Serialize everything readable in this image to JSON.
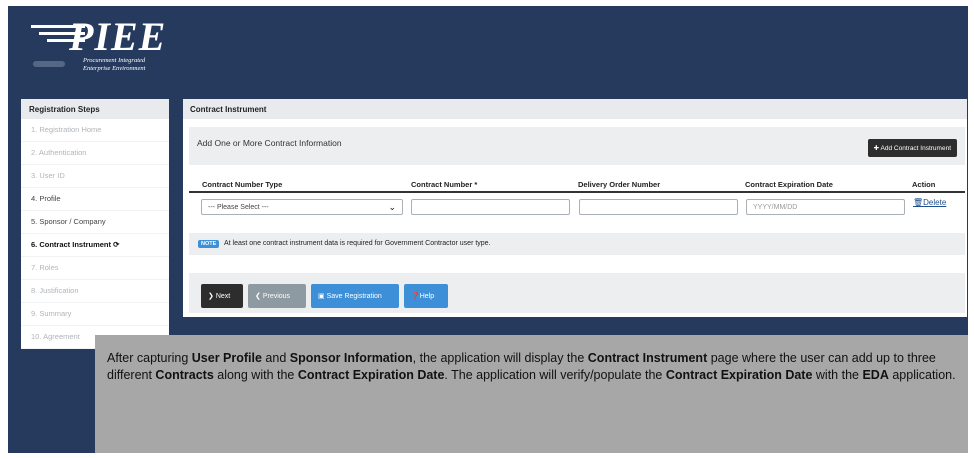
{
  "logo": {
    "wordmark": "PIEE",
    "subtitle_line1": "Procurement Integrated",
    "subtitle_line2": "Enterprise Environment"
  },
  "sidebar": {
    "title": "Registration Steps",
    "steps": [
      {
        "label": "1. Registration Home",
        "state": "disabled"
      },
      {
        "label": "2. Authentication",
        "state": "disabled"
      },
      {
        "label": "3. User ID",
        "state": "disabled"
      },
      {
        "label": "4. Profile",
        "state": "done"
      },
      {
        "label": "5. Sponsor / Company",
        "state": "done"
      },
      {
        "label": "6. Contract Instrument",
        "state": "current"
      },
      {
        "label": "7. Roles",
        "state": "disabled"
      },
      {
        "label": "8. Justification",
        "state": "disabled"
      },
      {
        "label": "9. Summary",
        "state": "disabled"
      },
      {
        "label": "10. Agreement",
        "state": "disabled"
      }
    ]
  },
  "main": {
    "title": "Contract Instrument",
    "info": "Add One or More Contract Information",
    "add_button": "Add Contract Instrument",
    "columns": [
      "Contract Number Type",
      "Contract Number *",
      "Delivery Order Number",
      "Contract Expiration Date",
      "Action"
    ],
    "row": {
      "type_select": "--- Please Select ---",
      "contract_number": "",
      "delivery_order_number": "",
      "expiration_placeholder": "YYYY/MM/DD",
      "delete_label": "Delete"
    },
    "note_badge": "NOTE",
    "note_text": "At least one contract instrument data is required for Government Contractor user type.",
    "buttons": {
      "next": "Next",
      "previous": "Previous",
      "save": "Save Registration",
      "help": "Help"
    }
  },
  "caption": {
    "parts": [
      {
        "t": "After capturing ",
        "b": false
      },
      {
        "t": "User Profile",
        "b": true
      },
      {
        "t": " and ",
        "b": false
      },
      {
        "t": "Sponsor Information",
        "b": true
      },
      {
        "t": ", the application will display the ",
        "b": false
      },
      {
        "t": "Contract Instrument",
        "b": true
      },
      {
        "t": " page where the user can add up to three different ",
        "b": false
      },
      {
        "t": "Contracts",
        "b": true
      },
      {
        "t": " along with the ",
        "b": false
      },
      {
        "t": "Contract Expiration Date",
        "b": true
      },
      {
        "t": ". The application will verify/populate the ",
        "b": false
      },
      {
        "t": "Contract Expiration Date",
        "b": true
      },
      {
        "t": " with the ",
        "b": false
      },
      {
        "t": "EDA",
        "b": true
      },
      {
        "t": " application.",
        "b": false
      }
    ]
  },
  "colors": {
    "background": "#263a5e",
    "primary_button": "#3d8fd8",
    "dark_button": "#2d2d2d",
    "muted_button": "#8e9aa2"
  }
}
